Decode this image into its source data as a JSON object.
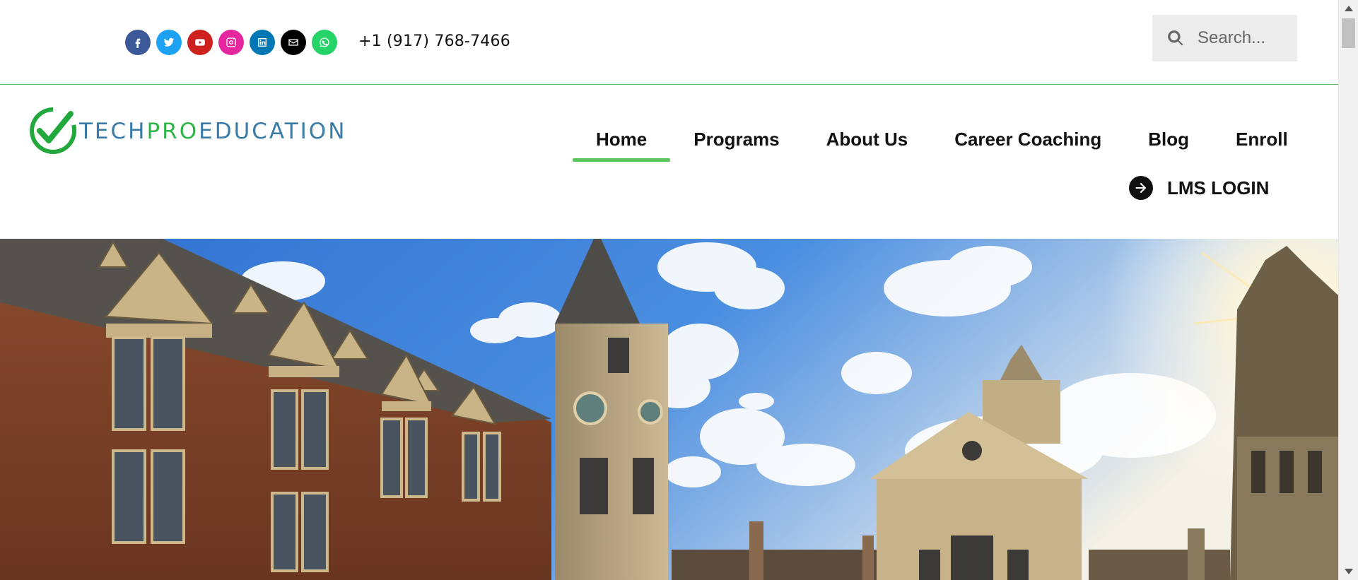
{
  "topbar": {
    "socials": [
      {
        "name": "facebook-icon",
        "color": "#3b5998"
      },
      {
        "name": "twitter-icon",
        "color": "#1da1f2"
      },
      {
        "name": "youtube-icon",
        "color": "#cd201f"
      },
      {
        "name": "instagram-icon",
        "color": "#e4279e"
      },
      {
        "name": "linkedin-icon",
        "color": "#0077b5"
      },
      {
        "name": "envelope-icon",
        "color": "#000000"
      },
      {
        "name": "whatsapp-icon",
        "color": "#25d366"
      }
    ],
    "phone": "+1 (917) 768-7466",
    "search_placeholder": "Search..."
  },
  "logo": {
    "part1": "TECH",
    "part2": "PRO",
    "part3": "EDUCATION",
    "colors": {
      "blue": "#3a7ba8",
      "green": "#2fb648"
    }
  },
  "nav": {
    "items": [
      {
        "label": "Home",
        "active": true
      },
      {
        "label": "Programs"
      },
      {
        "label": "About Us"
      },
      {
        "label": "Career Coaching"
      },
      {
        "label": "Blog"
      },
      {
        "label": "Enroll"
      }
    ],
    "lms_label": "LMS LOGIN",
    "accent": "#5cc45c"
  },
  "hero": {
    "image": "university-buildings-sky-photo"
  }
}
